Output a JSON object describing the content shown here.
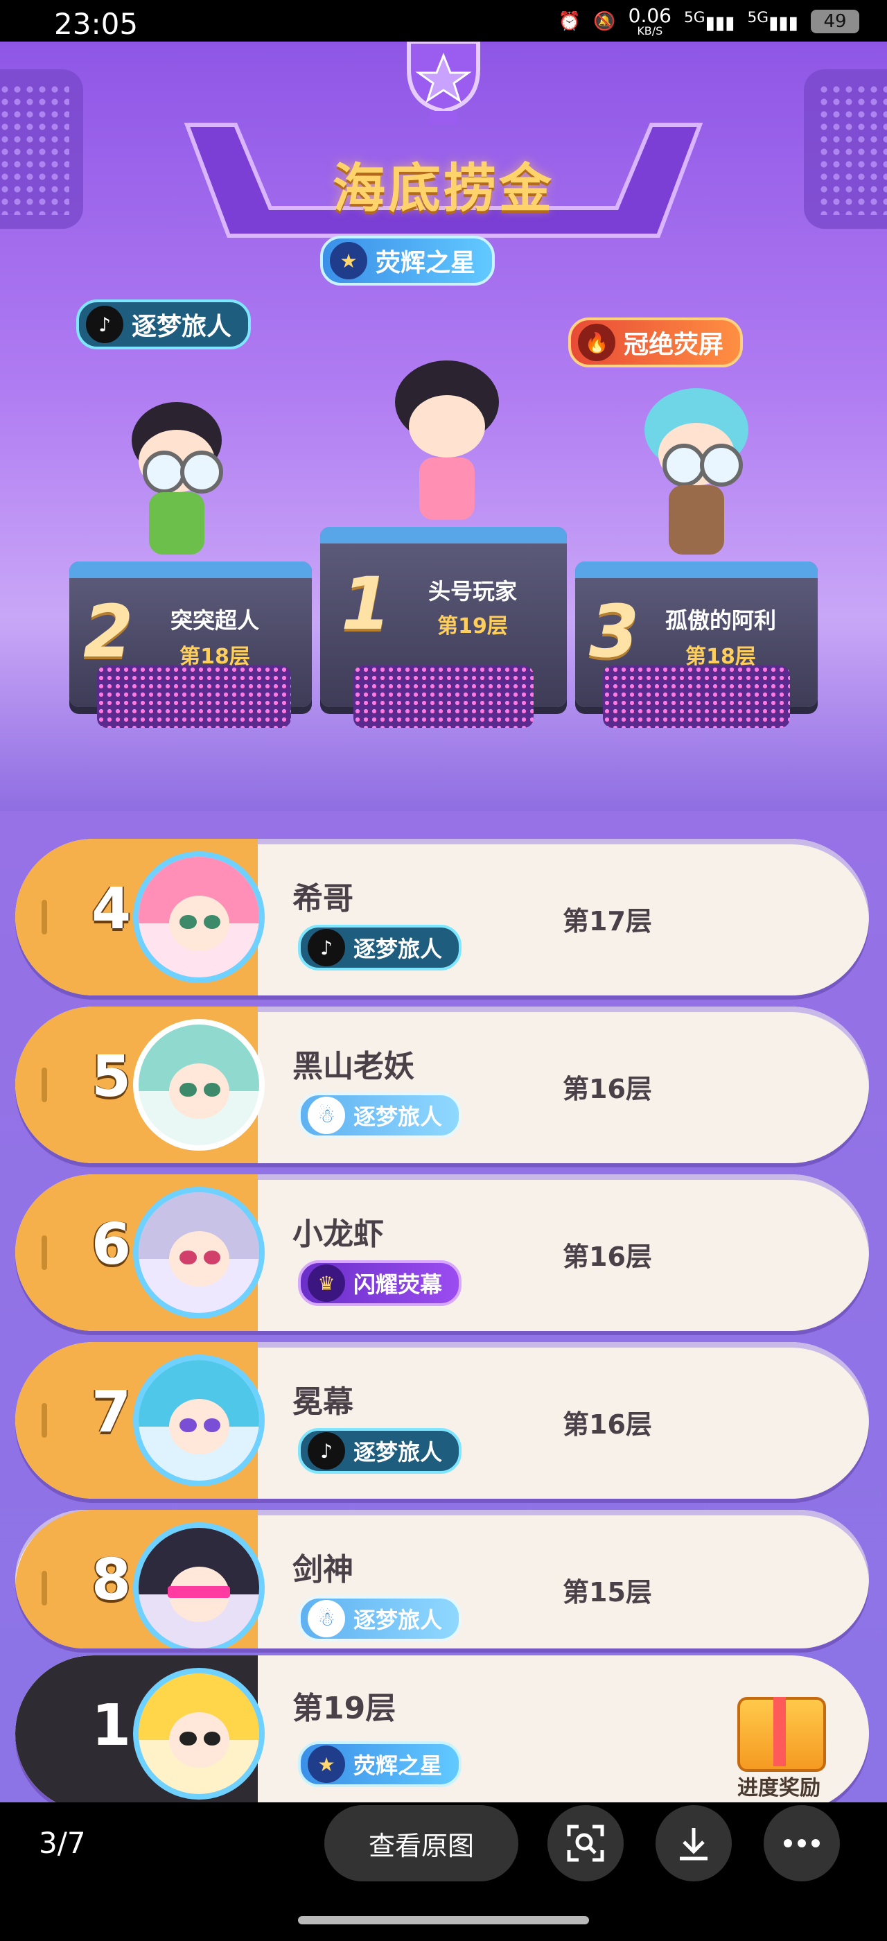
{
  "status_bar": {
    "time": "23:05",
    "speed_value": "0.06",
    "speed_unit": "KB/S",
    "network_1": "5G",
    "network_2": "5G",
    "battery": "49"
  },
  "game": {
    "title": "海底捞金",
    "center_badge": "荧辉之星",
    "left_badge": "逐梦旅人",
    "right_badge": "冠绝荧屏",
    "podium": [
      {
        "rank": "2",
        "name": "突突超人",
        "floor": "第18层"
      },
      {
        "rank": "1",
        "name": "头号玩家",
        "floor": "第19层"
      },
      {
        "rank": "3",
        "name": "孤傲的阿利",
        "floor": "第18层"
      }
    ],
    "ranking": [
      {
        "rank": "4",
        "name": "希哥",
        "badge": "逐梦旅人",
        "floor": "第17层"
      },
      {
        "rank": "5",
        "name": "黑山老妖",
        "badge": "逐梦旅人",
        "floor": "第16层"
      },
      {
        "rank": "6",
        "name": "小龙虾",
        "badge": "闪耀荧幕",
        "floor": "第16层"
      },
      {
        "rank": "7",
        "name": "冕幕",
        "badge": "逐梦旅人",
        "floor": "第16层"
      },
      {
        "rank": "8",
        "name": "剑神",
        "badge": "逐梦旅人",
        "floor": "第15层"
      }
    ],
    "my_rank": {
      "rank": "1",
      "floor": "第19层",
      "badge": "荧辉之星",
      "reward_label": "进度奖励"
    }
  },
  "viewer": {
    "pager": "3/7",
    "view_original": "查看原图",
    "icons": [
      "scan-icon",
      "download-icon",
      "more-icon"
    ]
  }
}
